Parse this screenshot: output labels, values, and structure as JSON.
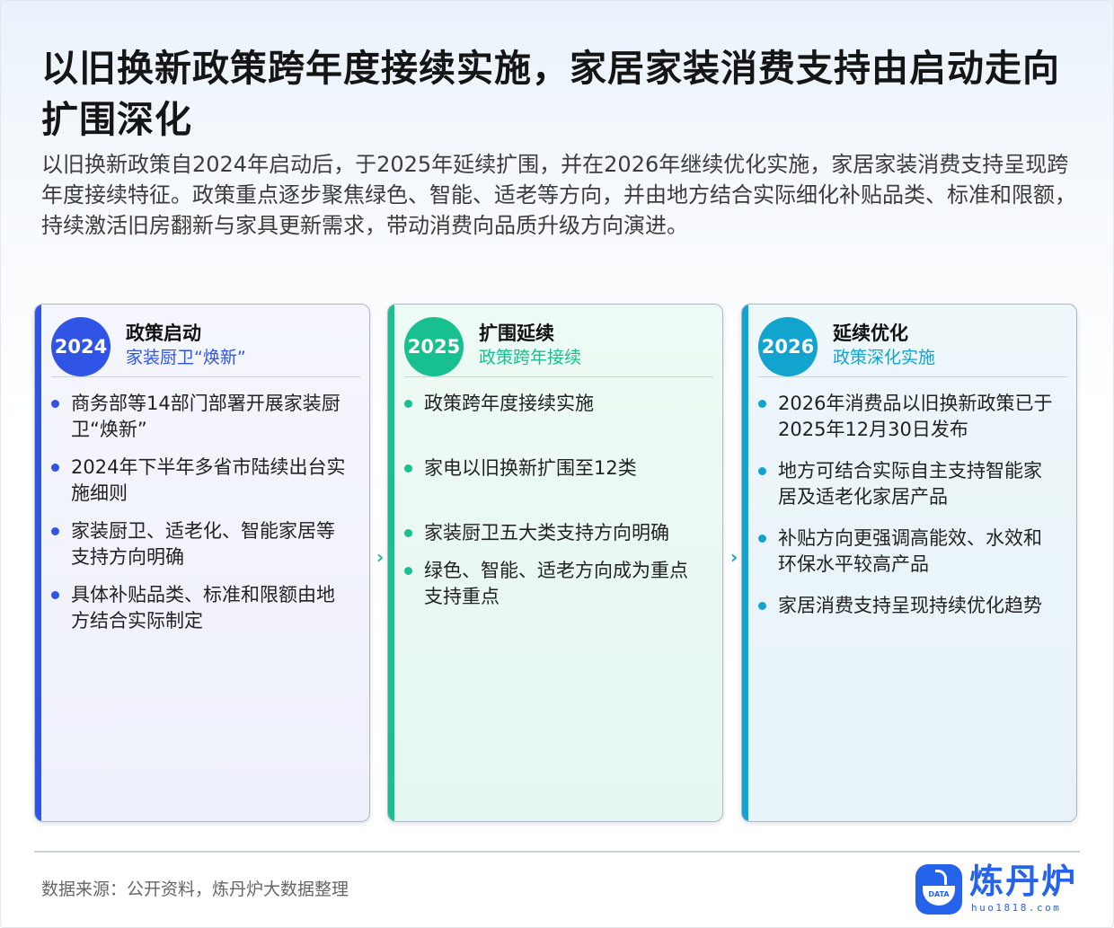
{
  "title": "以旧换新政策跨年度接续实施，家居家装消费支持由启动走向扩围深化",
  "intro": "以旧换新政策自2024年启动后，于2025年延续扩围，并在2026年继续优化实施，家居家装消费支持呈现跨年度接续特征。政策重点逐步聚焦绿色、智能、适老等方向，并由地方结合实际细化补贴品类、标准和限额，持续激活旧房翻新与家具更新需求，带动消费向品质升级方向演进。",
  "cards": [
    {
      "year": "2024",
      "title": "政策启动",
      "subtitle": "家装厨卫“焕新”",
      "color": "#2f54e6",
      "items": [
        "商务部等14部门部署开展家装厨卫“焕新”",
        "2024年下半年多省市陆续出台实施细则",
        "家装厨卫、适老化、智能家居等支持方向明确",
        "具体补贴品类、标准和限额由地方结合实际制定"
      ]
    },
    {
      "year": "2025",
      "title": "扩围延续",
      "subtitle": "政策跨年接续",
      "color": "#17c08e",
      "items": [
        "政策跨年度接续实施",
        "家电以旧换新扩围至12类",
        "家装厨卫五大类支持方向明确",
        "绿色、智能、适老方向成为重点支持重点"
      ]
    },
    {
      "year": "2026",
      "title": "延续优化",
      "subtitle": "政策深化实施",
      "color": "#12a3cf",
      "items": [
        "2026年消费品以旧换新政策已于2025年12月30日发布",
        "地方可结合实际自主支持智能家居及适老化家居产品",
        "补贴方向更强调高能效、水效和环保水平较高产品",
        "家居消费支持呈现持续优化趋势"
      ]
    }
  ],
  "connector": "›",
  "source": "数据来源：公开资料，炼丹炉大数据整理",
  "logo": {
    "name": "炼丹炉",
    "url": "huo1818.com",
    "badge": "DATA"
  }
}
